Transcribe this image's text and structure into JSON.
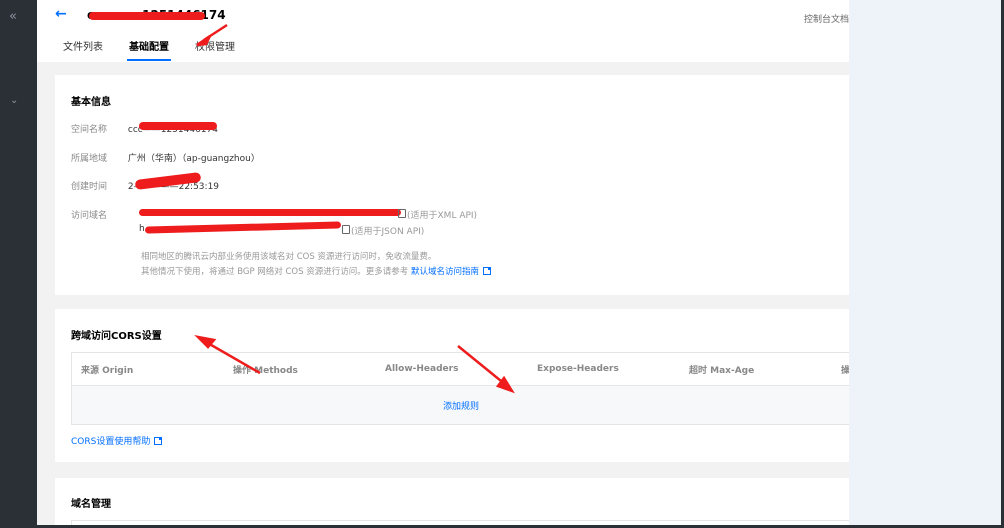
{
  "header": {
    "title": "c————1251446174",
    "right_link": "控制台文档",
    "tabs": [
      {
        "label": "文件列表",
        "active": false
      },
      {
        "label": "基础配置",
        "active": true
      },
      {
        "label": "权限管理",
        "active": false
      }
    ]
  },
  "basic_info": {
    "title": "基本信息",
    "space_name": {
      "label": "空间名称",
      "value": "ccc——1251446174"
    },
    "region": {
      "label": "所属地域",
      "value": "广州（华南）（ap-guangzhou）"
    },
    "created": {
      "label": "创建时间",
      "value": "2—————22:53:19"
    },
    "domain": {
      "label": "访问域名",
      "xml_note": "(适用于XML API)",
      "json_prefix": "h",
      "json_note": "(适用于JSON API)",
      "note1": "相同地区的腾讯云内部业务使用该域名对 COS 资源进行访问时，免收流量费。",
      "note2_prefix": "其他情况下使用，将通过 BGP 网络对 COS 资源进行访问。更多请参考",
      "note2_link": "默认域名访问指南"
    }
  },
  "cors": {
    "title": "跨域访问CORS设置",
    "columns": [
      "来源 Origin",
      "操作 Methods",
      "Allow-Headers",
      "Expose-Headers",
      "超时 Max-Age",
      "操"
    ],
    "add_rule": "添加规则",
    "help_link": "CORS设置使用帮助"
  },
  "domain_mgmt": {
    "title": "域名管理"
  },
  "colors": {
    "accent": "#006eff",
    "annotation_red": "#ee1c1c",
    "sidebar_dark": "#2b2f36"
  },
  "icons": [
    "collapse-icon",
    "expand-icon",
    "back-arrow-icon",
    "copy-icon",
    "external-link-icon"
  ]
}
